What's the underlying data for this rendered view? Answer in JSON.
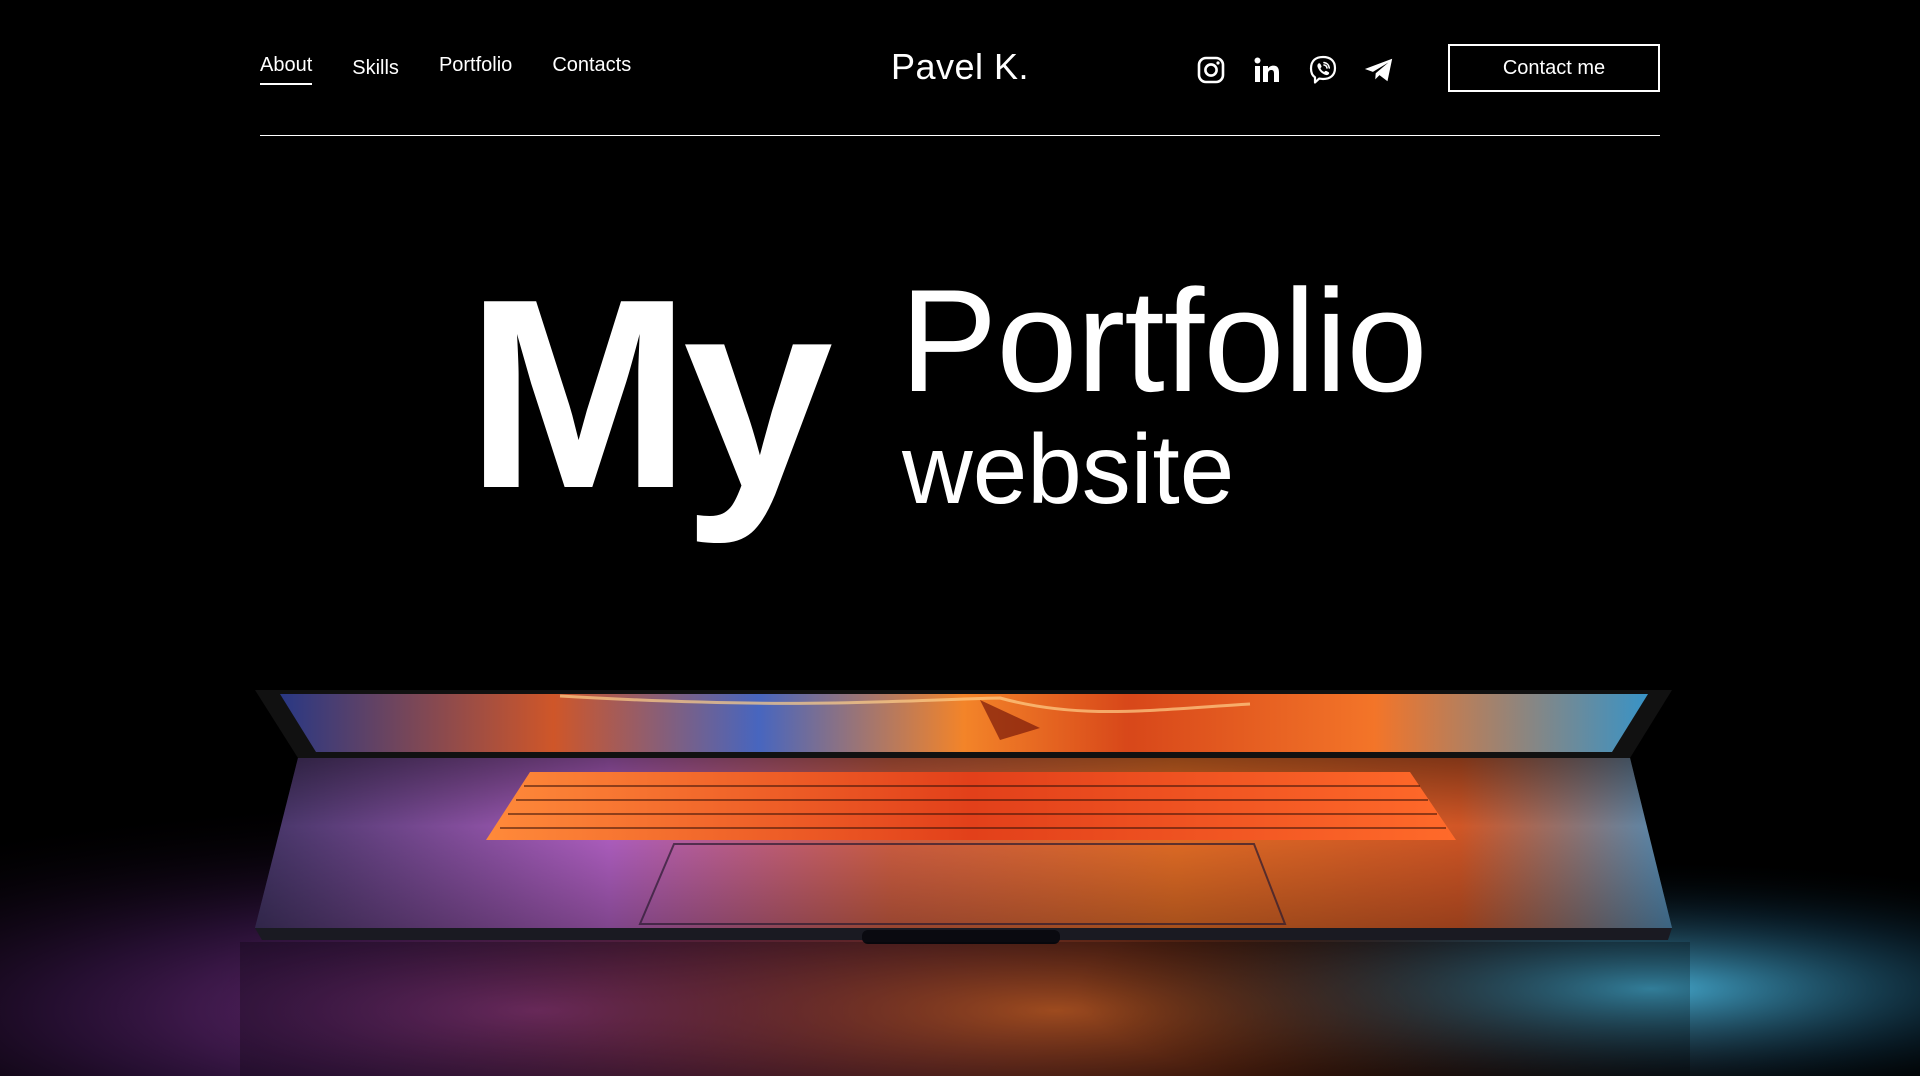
{
  "nav": {
    "items": [
      {
        "label": "About",
        "active": true
      },
      {
        "label": "Skills",
        "active": false
      },
      {
        "label": "Portfolio",
        "active": false
      },
      {
        "label": "Contacts",
        "active": false
      }
    ]
  },
  "brand": {
    "name": "Pavel K."
  },
  "socials": [
    {
      "icon": "instagram-icon"
    },
    {
      "icon": "linkedin-icon"
    },
    {
      "icon": "viber-icon"
    },
    {
      "icon": "telegram-icon"
    }
  ],
  "cta": {
    "label": "Contact me"
  },
  "hero": {
    "word_big": "My",
    "word_main": "Portfolio",
    "word_sub": "website"
  },
  "colors": {
    "background": "#000000",
    "text": "#ffffff",
    "glow_orange": "#ff6a1a",
    "glow_purple": "#b04bd8",
    "glow_blue": "#3bb4e8"
  }
}
